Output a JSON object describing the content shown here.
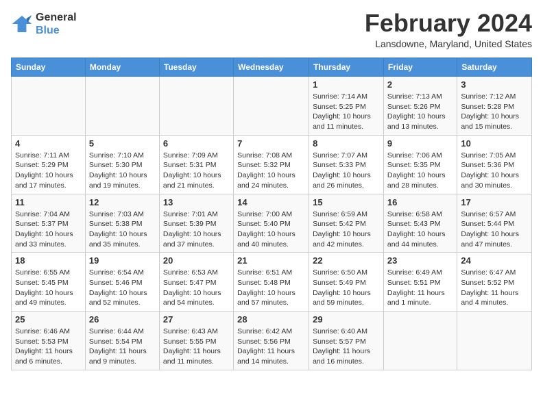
{
  "header": {
    "logo_line1": "General",
    "logo_line2": "Blue",
    "month_year": "February 2024",
    "location": "Lansdowne, Maryland, United States"
  },
  "weekdays": [
    "Sunday",
    "Monday",
    "Tuesday",
    "Wednesday",
    "Thursday",
    "Friday",
    "Saturday"
  ],
  "weeks": [
    [
      {
        "day": "",
        "info": ""
      },
      {
        "day": "",
        "info": ""
      },
      {
        "day": "",
        "info": ""
      },
      {
        "day": "",
        "info": ""
      },
      {
        "day": "1",
        "info": "Sunrise: 7:14 AM\nSunset: 5:25 PM\nDaylight: 10 hours\nand 11 minutes."
      },
      {
        "day": "2",
        "info": "Sunrise: 7:13 AM\nSunset: 5:26 PM\nDaylight: 10 hours\nand 13 minutes."
      },
      {
        "day": "3",
        "info": "Sunrise: 7:12 AM\nSunset: 5:28 PM\nDaylight: 10 hours\nand 15 minutes."
      }
    ],
    [
      {
        "day": "4",
        "info": "Sunrise: 7:11 AM\nSunset: 5:29 PM\nDaylight: 10 hours\nand 17 minutes."
      },
      {
        "day": "5",
        "info": "Sunrise: 7:10 AM\nSunset: 5:30 PM\nDaylight: 10 hours\nand 19 minutes."
      },
      {
        "day": "6",
        "info": "Sunrise: 7:09 AM\nSunset: 5:31 PM\nDaylight: 10 hours\nand 21 minutes."
      },
      {
        "day": "7",
        "info": "Sunrise: 7:08 AM\nSunset: 5:32 PM\nDaylight: 10 hours\nand 24 minutes."
      },
      {
        "day": "8",
        "info": "Sunrise: 7:07 AM\nSunset: 5:33 PM\nDaylight: 10 hours\nand 26 minutes."
      },
      {
        "day": "9",
        "info": "Sunrise: 7:06 AM\nSunset: 5:35 PM\nDaylight: 10 hours\nand 28 minutes."
      },
      {
        "day": "10",
        "info": "Sunrise: 7:05 AM\nSunset: 5:36 PM\nDaylight: 10 hours\nand 30 minutes."
      }
    ],
    [
      {
        "day": "11",
        "info": "Sunrise: 7:04 AM\nSunset: 5:37 PM\nDaylight: 10 hours\nand 33 minutes."
      },
      {
        "day": "12",
        "info": "Sunrise: 7:03 AM\nSunset: 5:38 PM\nDaylight: 10 hours\nand 35 minutes."
      },
      {
        "day": "13",
        "info": "Sunrise: 7:01 AM\nSunset: 5:39 PM\nDaylight: 10 hours\nand 37 minutes."
      },
      {
        "day": "14",
        "info": "Sunrise: 7:00 AM\nSunset: 5:40 PM\nDaylight: 10 hours\nand 40 minutes."
      },
      {
        "day": "15",
        "info": "Sunrise: 6:59 AM\nSunset: 5:42 PM\nDaylight: 10 hours\nand 42 minutes."
      },
      {
        "day": "16",
        "info": "Sunrise: 6:58 AM\nSunset: 5:43 PM\nDaylight: 10 hours\nand 44 minutes."
      },
      {
        "day": "17",
        "info": "Sunrise: 6:57 AM\nSunset: 5:44 PM\nDaylight: 10 hours\nand 47 minutes."
      }
    ],
    [
      {
        "day": "18",
        "info": "Sunrise: 6:55 AM\nSunset: 5:45 PM\nDaylight: 10 hours\nand 49 minutes."
      },
      {
        "day": "19",
        "info": "Sunrise: 6:54 AM\nSunset: 5:46 PM\nDaylight: 10 hours\nand 52 minutes."
      },
      {
        "day": "20",
        "info": "Sunrise: 6:53 AM\nSunset: 5:47 PM\nDaylight: 10 hours\nand 54 minutes."
      },
      {
        "day": "21",
        "info": "Sunrise: 6:51 AM\nSunset: 5:48 PM\nDaylight: 10 hours\nand 57 minutes."
      },
      {
        "day": "22",
        "info": "Sunrise: 6:50 AM\nSunset: 5:49 PM\nDaylight: 10 hours\nand 59 minutes."
      },
      {
        "day": "23",
        "info": "Sunrise: 6:49 AM\nSunset: 5:51 PM\nDaylight: 11 hours\nand 1 minute."
      },
      {
        "day": "24",
        "info": "Sunrise: 6:47 AM\nSunset: 5:52 PM\nDaylight: 11 hours\nand 4 minutes."
      }
    ],
    [
      {
        "day": "25",
        "info": "Sunrise: 6:46 AM\nSunset: 5:53 PM\nDaylight: 11 hours\nand 6 minutes."
      },
      {
        "day": "26",
        "info": "Sunrise: 6:44 AM\nSunset: 5:54 PM\nDaylight: 11 hours\nand 9 minutes."
      },
      {
        "day": "27",
        "info": "Sunrise: 6:43 AM\nSunset: 5:55 PM\nDaylight: 11 hours\nand 11 minutes."
      },
      {
        "day": "28",
        "info": "Sunrise: 6:42 AM\nSunset: 5:56 PM\nDaylight: 11 hours\nand 14 minutes."
      },
      {
        "day": "29",
        "info": "Sunrise: 6:40 AM\nSunset: 5:57 PM\nDaylight: 11 hours\nand 16 minutes."
      },
      {
        "day": "",
        "info": ""
      },
      {
        "day": "",
        "info": ""
      }
    ]
  ]
}
